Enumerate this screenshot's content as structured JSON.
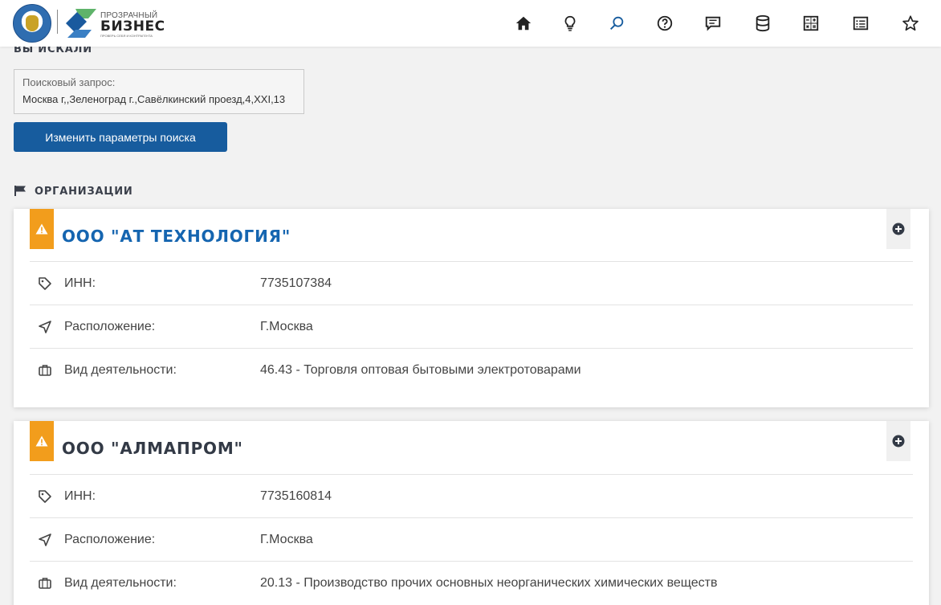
{
  "header": {
    "brand_small": "ПРОЗРАЧНЫЙ",
    "brand_big": "БИЗНЕС",
    "brand_tagline": "ПРОВЕРЬ СЕБЯ И КОНТРАГЕНТА",
    "nav_icons": [
      "home-icon",
      "lightbulb-icon",
      "search-icon",
      "help-icon",
      "chat-icon",
      "database-icon",
      "calculator-icon",
      "list-icon",
      "star-icon"
    ],
    "active_icon": "search-icon",
    "accent_color": "#175c9e"
  },
  "search": {
    "section_title": "ВЫ ИСКАЛИ",
    "query_label": "Поисковый запрос:",
    "query_value": "Москва г,,Зеленоград г.,Савёлкинский проезд,4,XXI,13",
    "change_button": "Изменить параметры поиска"
  },
  "orgs": {
    "section_title": "ОРГАНИЗАЦИИ",
    "warning_color": "#f29d1c",
    "items": [
      {
        "name": "ООО \"АТ ТЕХНОЛОГИЯ\"",
        "inn_label": "ИНН:",
        "inn": "7735107384",
        "location_label": "Расположение:",
        "location": "Г.Москва",
        "activity_label": "Вид деятельности:",
        "activity": "46.43 - Торговля оптовая бытовыми электротоварами"
      },
      {
        "name": "ООО \"АЛМАПРОМ\"",
        "inn_label": "ИНН:",
        "inn": "7735160814",
        "location_label": "Расположение:",
        "location": "Г.Москва",
        "activity_label": "Вид деятельности:",
        "activity": "20.13 - Производство прочих основных неорганических химических веществ"
      }
    ]
  }
}
